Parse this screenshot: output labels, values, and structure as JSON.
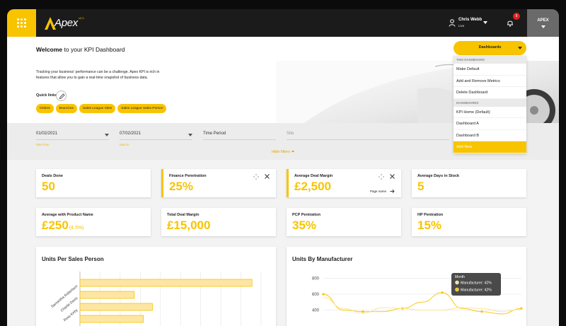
{
  "app": {
    "name": "Apex",
    "logo_sup": "v2.0"
  },
  "user": {
    "name": "Chris Webb",
    "status": "Live"
  },
  "notifications": {
    "count": "9"
  },
  "org_menu": {
    "label": "APEX"
  },
  "page": {
    "welcome_bold": "Welcome",
    "welcome_rest": " to your KPI Dashboard"
  },
  "intro": {
    "text": "Tracking your business' performance can be a challenge. Apex KPI is rich in features that allow you to gain a real-time snapshot of business data.",
    "quick_links_label": "Quick links",
    "quick_links": [
      "Orders",
      "Branches",
      "Sales League Sites",
      "Sales League Sales Person"
    ]
  },
  "filters": {
    "date_from": "01/02/2021",
    "date_from_hint": "Date from",
    "date_to": "07/02/2021",
    "date_to_hint": "Date to",
    "time_period": "Time Period",
    "site": "Site",
    "hide_label": "Hide filters"
  },
  "dropdown": {
    "label": "Dashboards",
    "section1": "THIS DASHBOARD",
    "section1_items": [
      "Make Default",
      "Add and Remove Metrics",
      "Delete Dashboard"
    ],
    "section2": "DASHBOARDS",
    "section2_items": [
      "KPI Home (Default)",
      "Dashboard A",
      "Dashboard B"
    ],
    "add_new": "Add New"
  },
  "kpis": [
    {
      "label": "Deals Done",
      "value": "50"
    },
    {
      "label": "Finance Penetration",
      "value": "25%"
    },
    {
      "label": "Average Deal Margin",
      "value": "£2,500",
      "page_name": "Page name"
    },
    {
      "label": "Average Days in Stock",
      "value": "5"
    },
    {
      "label": "Average with Product Name",
      "value": "£250",
      "sub": "(4.5%)"
    },
    {
      "label": "Total Deal Margin",
      "value": "£15,000"
    },
    {
      "label": "PCP Pentration",
      "value": "35%"
    },
    {
      "label": "HP Pentration",
      "value": "15%"
    }
  ],
  "colors": {
    "accent": "#f8c400",
    "topbar": "#1b1b1b"
  },
  "chart_data": [
    {
      "type": "bar",
      "title": "Units Per Sales Person",
      "orientation": "horizontal",
      "categories": [
        "Samantha Robertson",
        "Charlie Davis",
        "Ross Kirby",
        ""
      ],
      "values": [
        95,
        30,
        40,
        35
      ],
      "xlim": [
        0,
        100
      ],
      "grid": true
    },
    {
      "type": "line",
      "title": "Units By Manufacturer",
      "y_ticks": [
        "800",
        "600",
        "400"
      ],
      "ylim": [
        350,
        850
      ],
      "series": [
        {
          "values": [
            600,
            400,
            380,
            380,
            420,
            500,
            620,
            420,
            380,
            350,
            420
          ]
        },
        {
          "values": [
            560,
            420,
            360,
            430,
            420,
            400,
            400,
            430,
            420,
            380,
            410
          ]
        }
      ],
      "tooltip": {
        "title": "Month",
        "lines": [
          "Manufacturer: 42%",
          "Manufacturer: 42%"
        ]
      }
    }
  ]
}
